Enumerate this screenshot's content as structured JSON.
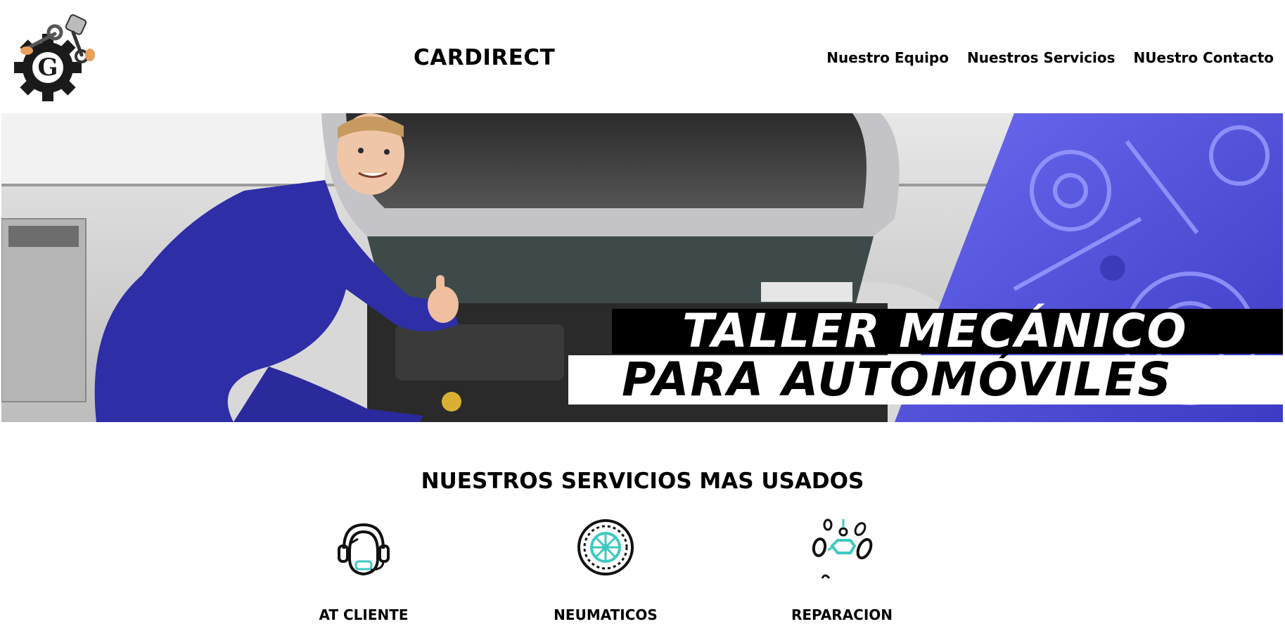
{
  "header": {
    "logo_icon": "mechanic-gear-wrench-logo-icon",
    "brand": "CARDIRECT",
    "nav": [
      {
        "label": "Nuestro Equipo"
      },
      {
        "label": "Nuestros Servicios"
      },
      {
        "label": "NUestro Contacto"
      }
    ]
  },
  "hero": {
    "line1": "TALLER MECÁNICO",
    "line2": "PARA AUTOMÓVILES",
    "accent_color": "#4a4ad6"
  },
  "services": {
    "title": "NUESTROS SERVICIOS MAS USADOS",
    "items": [
      {
        "label": "AT CLIENTE",
        "icon": "headset-agent-icon"
      },
      {
        "label": "NEUMATICOS",
        "icon": "tire-wheel-icon"
      },
      {
        "label": "REPARACION",
        "icon": "engine-repair-icon"
      }
    ],
    "icon_accent": "#3fc9c2"
  }
}
